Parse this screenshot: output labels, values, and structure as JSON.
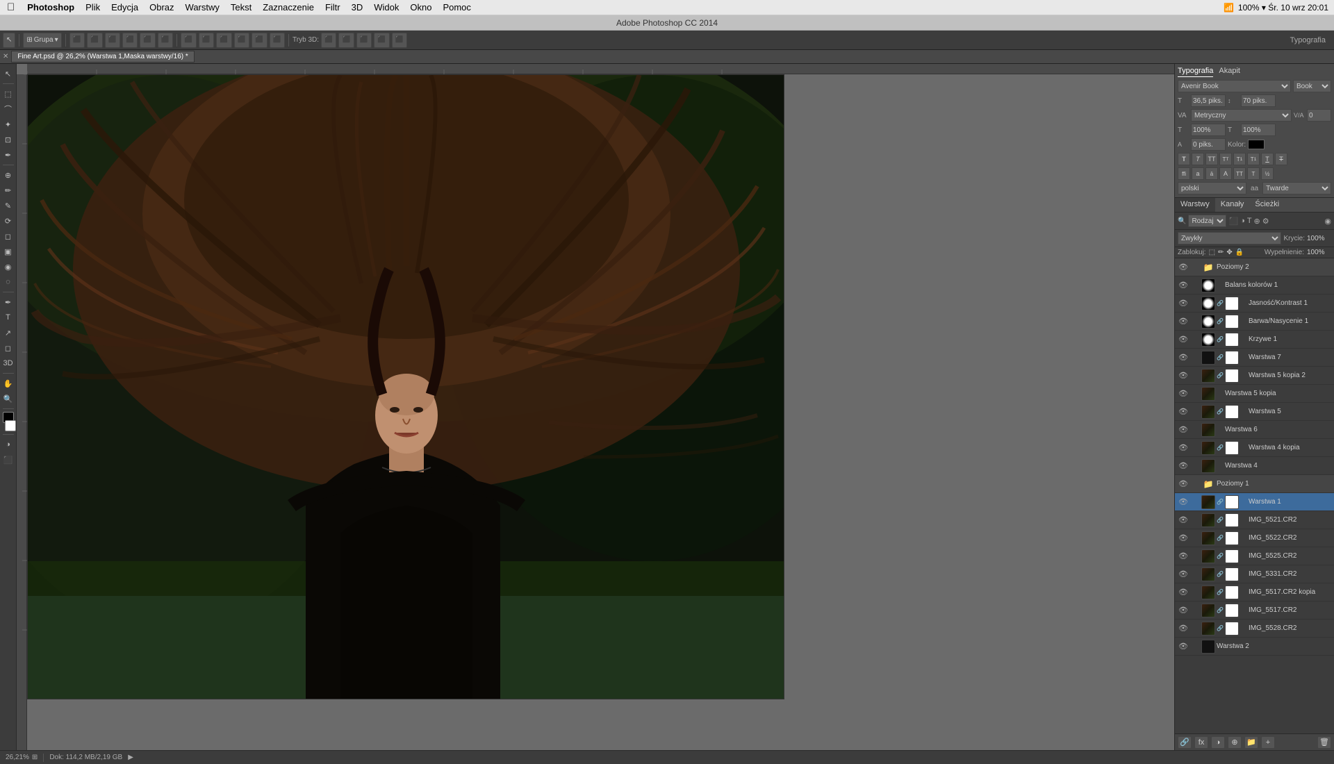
{
  "app": {
    "name": "Photoshop",
    "title": "Adobe Photoshop CC 2014",
    "version": "CC 2014"
  },
  "menubar": {
    "apple": "⌘",
    "items": [
      "Photoshop",
      "Plik",
      "Edycja",
      "Obraz",
      "Warstwy",
      "Tekst",
      "Zaznaczenie",
      "Filtr",
      "3D",
      "Widok",
      "Okno",
      "Pomoc"
    ],
    "right": "100% ▾  Śr. 10 wrz  20:01"
  },
  "titlebar": {
    "text": "Adobe Photoshop CC 2014"
  },
  "toolbar": {
    "group_label": "Grupa",
    "mode_label": "Tryb 3D:",
    "typography_label": "Typografia"
  },
  "tab": {
    "filename": "Fine Art.psd @ 26,2% (Warstwa 1,Maska warstwy/16) *"
  },
  "typography": {
    "panel_title": "Typografia",
    "akapit_label": "Akapit",
    "font_family": "Avenir Book",
    "font_style": "Book",
    "font_size": "36,5 piks.",
    "leading": "70 piks.",
    "kerning_label": "VA",
    "kerning_type": "Metryczny",
    "tracking": "0",
    "scale_v": "100%",
    "scale_h": "100%",
    "baseline": "0 piks.",
    "color_label": "Kolor:",
    "lang": "polski",
    "aa_type": "Twarde",
    "text_icons": [
      "T",
      "T",
      "TT",
      "T",
      "T₁",
      "T",
      "T"
    ],
    "special_icons": [
      "ffi",
      "a",
      "ā",
      "A",
      "TT",
      "T",
      "ł½"
    ]
  },
  "layers": {
    "tabs": [
      "Warstwy",
      "Kanały",
      "Ścieżki"
    ],
    "search_placeholder": "Rodzaj",
    "blend_mode": "Zwykły",
    "opacity_label": "Krycie:",
    "opacity_value": "100%",
    "lock_label": "Zablokuj:",
    "fill_label": "Wypełnienie:",
    "fill_value": "100%",
    "items": [
      {
        "name": "Poziomy 2",
        "type": "group",
        "visible": true,
        "locked": false,
        "indent": 0,
        "thumb": "adjust",
        "has_mask": false
      },
      {
        "name": "Balans kolorów 1",
        "type": "adjustment",
        "visible": true,
        "locked": false,
        "indent": 1,
        "thumb": "adjust",
        "has_mask": false
      },
      {
        "name": "Jasność/Kontrast 1",
        "type": "adjustment",
        "visible": true,
        "locked": false,
        "indent": 1,
        "thumb": "adjust",
        "has_mask": true
      },
      {
        "name": "Barwa/Nasycenie 1",
        "type": "adjustment",
        "visible": true,
        "locked": false,
        "indent": 1,
        "thumb": "adjust",
        "has_mask": true
      },
      {
        "name": "Krzywe 1",
        "type": "adjustment",
        "visible": true,
        "locked": false,
        "indent": 1,
        "thumb": "curves",
        "has_mask": true
      },
      {
        "name": "Warstwa 7",
        "type": "layer",
        "visible": true,
        "locked": false,
        "indent": 1,
        "thumb": "dark",
        "has_mask": true
      },
      {
        "name": "Warstwa 5 kopia 2",
        "type": "layer",
        "visible": true,
        "locked": false,
        "indent": 1,
        "thumb": "photo",
        "has_mask": true
      },
      {
        "name": "Warstwa 5 kopia",
        "type": "layer",
        "visible": true,
        "locked": false,
        "indent": 1,
        "thumb": "photo",
        "has_mask": false
      },
      {
        "name": "Warstwa 5",
        "type": "layer",
        "visible": true,
        "locked": false,
        "indent": 1,
        "thumb": "photo",
        "has_mask": true
      },
      {
        "name": "Warstwa 6",
        "type": "layer",
        "visible": true,
        "locked": false,
        "indent": 1,
        "thumb": "photo",
        "has_mask": false
      },
      {
        "name": "Warstwa 4 kopia",
        "type": "layer",
        "visible": true,
        "locked": false,
        "indent": 1,
        "thumb": "photo",
        "has_mask": true
      },
      {
        "name": "Warstwa 4",
        "type": "layer",
        "visible": true,
        "locked": false,
        "indent": 1,
        "thumb": "photo",
        "has_mask": false
      },
      {
        "name": "Poziomy 1",
        "type": "group",
        "visible": true,
        "locked": false,
        "indent": 0,
        "thumb": "adjust",
        "has_mask": false
      },
      {
        "name": "Warstwa 1",
        "type": "layer",
        "visible": true,
        "locked": false,
        "indent": 1,
        "thumb": "photo",
        "has_mask": true,
        "active": true
      },
      {
        "name": "IMG_5521.CR2",
        "type": "layer",
        "visible": true,
        "locked": false,
        "indent": 1,
        "thumb": "photo",
        "has_mask": true
      },
      {
        "name": "IMG_5522.CR2",
        "type": "layer",
        "visible": true,
        "locked": false,
        "indent": 1,
        "thumb": "photo",
        "has_mask": true
      },
      {
        "name": "IMG_5525.CR2",
        "type": "layer",
        "visible": true,
        "locked": false,
        "indent": 1,
        "thumb": "photo",
        "has_mask": true
      },
      {
        "name": "IMG_5331.CR2",
        "type": "layer",
        "visible": true,
        "locked": false,
        "indent": 1,
        "thumb": "photo",
        "has_mask": true
      },
      {
        "name": "IMG_5517.CR2 kopia",
        "type": "layer",
        "visible": true,
        "locked": false,
        "indent": 1,
        "thumb": "photo",
        "has_mask": true
      },
      {
        "name": "IMG_5517.CR2",
        "type": "layer",
        "visible": true,
        "locked": false,
        "indent": 1,
        "thumb": "photo",
        "has_mask": true
      },
      {
        "name": "IMG_5528.CR2",
        "type": "layer",
        "visible": true,
        "locked": false,
        "indent": 1,
        "thumb": "photo",
        "has_mask": true
      },
      {
        "name": "Warstwa 2",
        "type": "layer",
        "visible": true,
        "locked": false,
        "indent": 0,
        "thumb": "dark",
        "has_mask": false
      }
    ]
  },
  "statusbar": {
    "zoom": "26,21%",
    "doc_info": "Dok: 114,2 MB/2,19 GB"
  }
}
